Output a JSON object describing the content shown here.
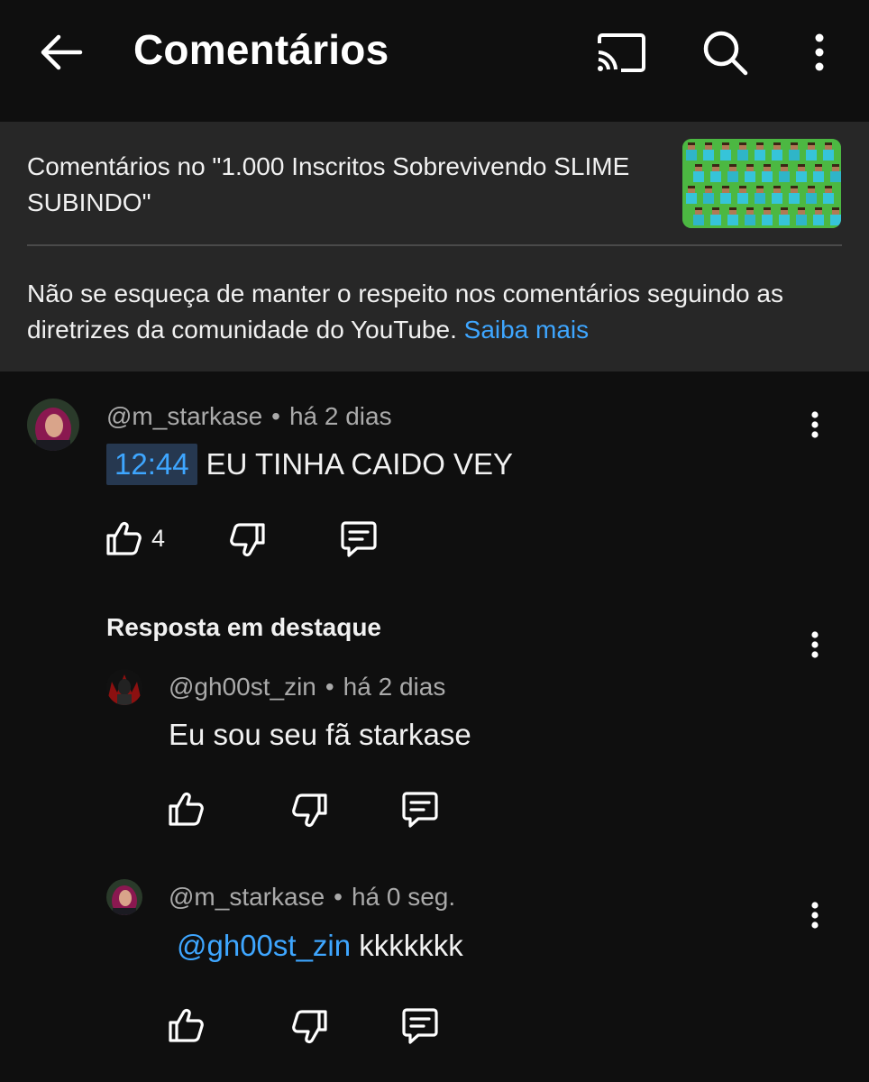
{
  "header": {
    "title": "Comentários",
    "icons": {
      "back": "arrow-left-icon",
      "cast": "cast-icon",
      "search": "search-icon",
      "more": "more-vertical-icon"
    }
  },
  "video_info": {
    "title_text": "Comentários no \"1.000 Inscritos Sobrevivendo SLIME SUBINDO\"",
    "guidelines_text": "Não se esqueça de manter o respeito nos comentários seguindo as diretrizes da comunidade do YouTube.",
    "learn_more": "Saiba mais"
  },
  "comment": {
    "author": "@m_starkase",
    "separator": "•",
    "time": "há 2 dias",
    "timestamp_link": "12:44",
    "text": "EU TINHA CAIDO VEY",
    "like_count": "4"
  },
  "highlighted_section": {
    "label": "Resposta em destaque"
  },
  "replies": [
    {
      "author": "@gh00st_zin",
      "separator": "•",
      "time": "há 2 dias",
      "text": "Eu sou seu fã starkase"
    },
    {
      "author": "@m_starkase",
      "separator": "•",
      "time": "há 0 seg.",
      "mention": "@gh00st_zin",
      "text": "kkkkkkk"
    }
  ],
  "colors": {
    "background": "#0f0f0f",
    "panel": "#272727",
    "link": "#3ea6ff",
    "secondary_text": "#aaaaaa"
  }
}
